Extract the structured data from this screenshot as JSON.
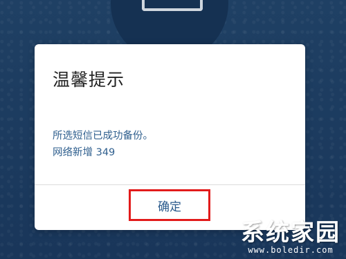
{
  "dialog": {
    "title": "温馨提示",
    "message_line1": "所选短信已成功备份。",
    "message_line2": "网络新增 349",
    "confirm_label": "确定"
  },
  "watermark": {
    "name": "系统家园",
    "url": "www.boledir.com"
  },
  "colors": {
    "background": "#1c3a5e",
    "message_text": "#2f5f8e",
    "highlight_border": "#e21b1b"
  }
}
